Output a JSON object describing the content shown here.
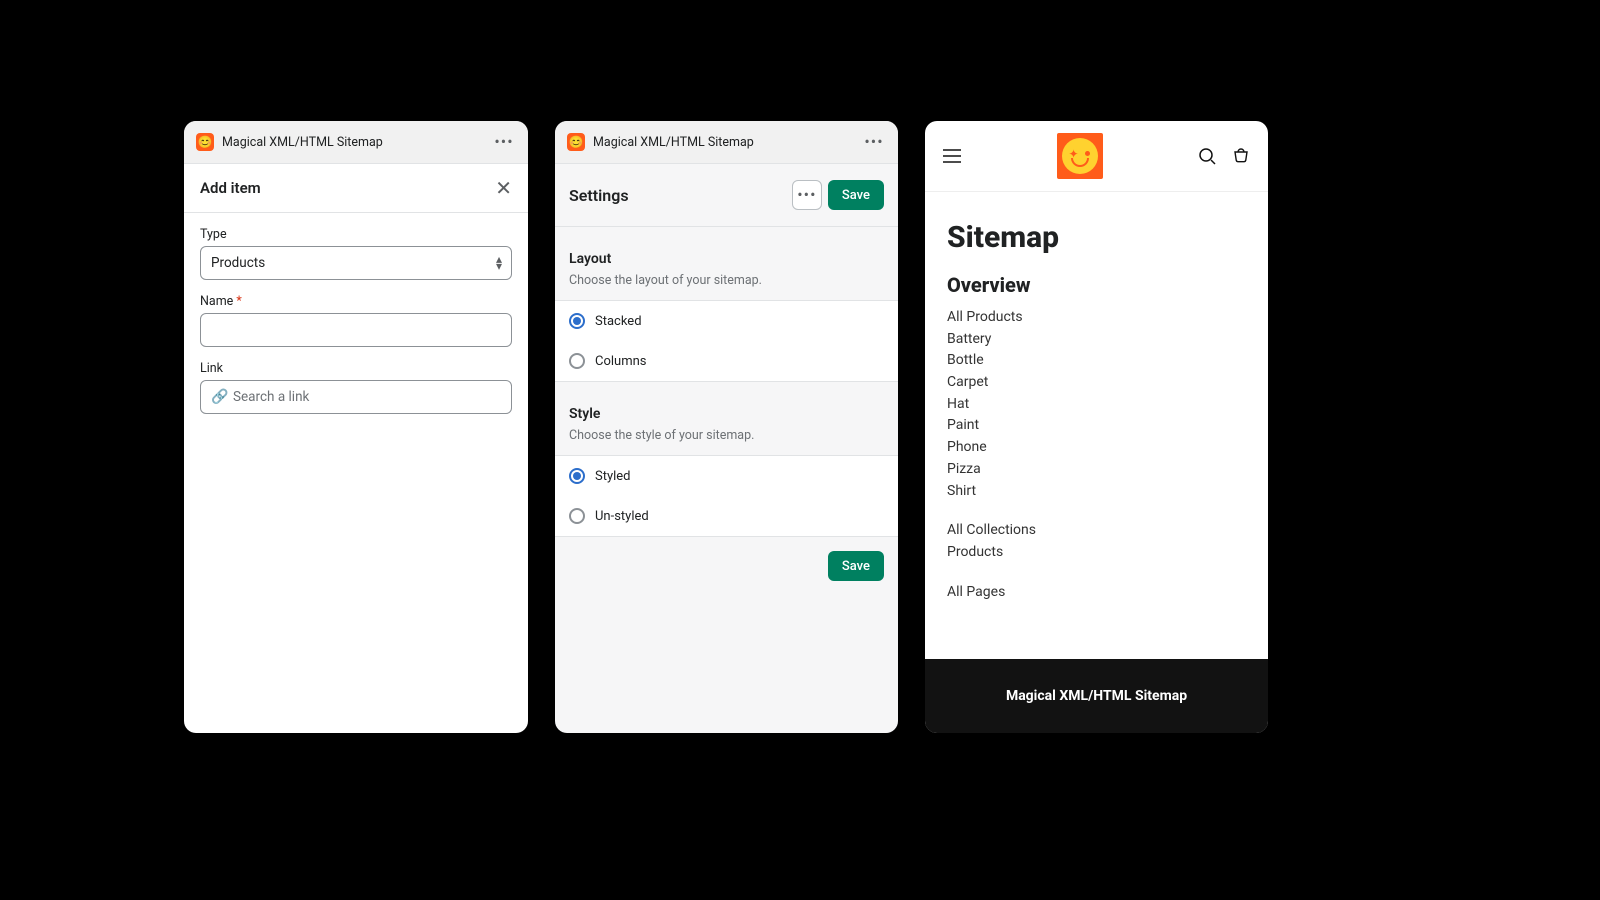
{
  "appTitle": "Magical XML/HTML Sitemap",
  "panel1": {
    "heading": "Add item",
    "labels": {
      "type": "Type",
      "name": "Name",
      "link": "Link"
    },
    "typeValue": "Products",
    "nameValue": "",
    "linkPlaceholder": "Search a link"
  },
  "panel2": {
    "heading": "Settings",
    "saveLabel": "Save",
    "layout": {
      "title": "Layout",
      "desc": "Choose the layout of your sitemap.",
      "options": {
        "stacked": "Stacked",
        "columns": "Columns"
      },
      "selected": "stacked"
    },
    "style": {
      "title": "Style",
      "desc": "Choose the style of your sitemap.",
      "options": {
        "styled": "Styled",
        "unstyled": "Un-styled"
      },
      "selected": "styled"
    }
  },
  "panel3": {
    "title": "Sitemap",
    "overview": "Overview",
    "products_heading": "All Products",
    "products": [
      "Battery",
      "Bottle",
      "Carpet",
      "Hat",
      "Paint",
      "Phone",
      "Pizza",
      "Shirt"
    ],
    "collections_heading": "All Collections",
    "collections": [
      "Products"
    ],
    "pages_heading": "All Pages",
    "footer": "Magical XML/HTML Sitemap"
  }
}
